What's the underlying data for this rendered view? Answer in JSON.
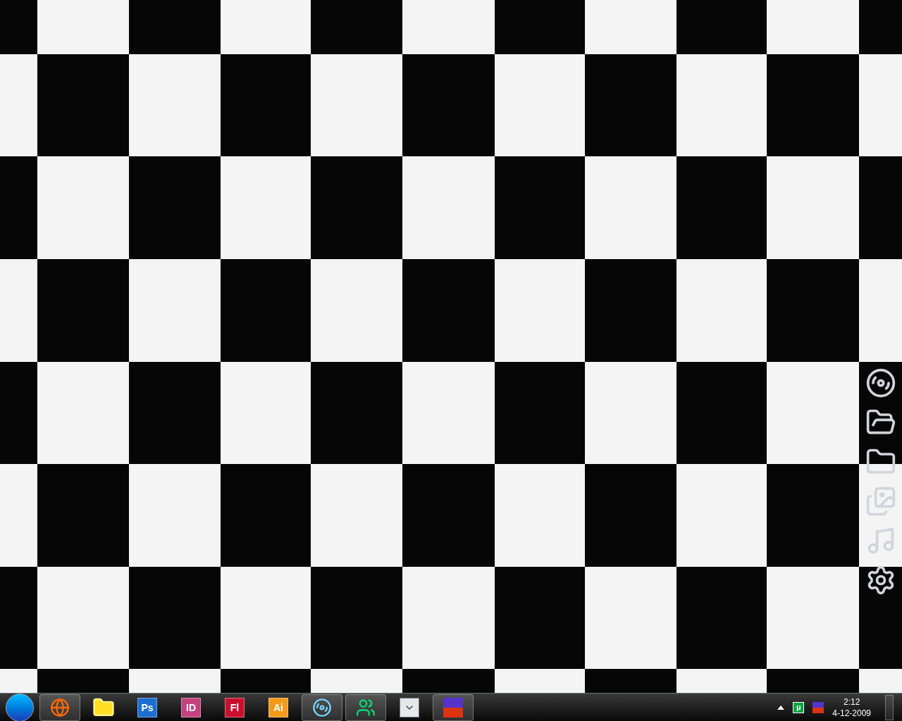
{
  "taskbar": {
    "items": [
      {
        "kind": "firefox",
        "running": true
      },
      {
        "kind": "explorer",
        "running": false
      },
      {
        "kind": "letter",
        "label": "Ps",
        "color": "#1c6fd1",
        "running": false
      },
      {
        "kind": "letter",
        "label": "ID",
        "color": "#c4407f",
        "running": false
      },
      {
        "kind": "letter",
        "label": "Fl",
        "color": "#c8102e",
        "running": false
      },
      {
        "kind": "letter",
        "label": "Ai",
        "color": "#f29b1b",
        "running": false
      },
      {
        "kind": "itunes",
        "running": true
      },
      {
        "kind": "messenger",
        "running": true
      },
      {
        "kind": "dropdown",
        "running": false
      },
      {
        "kind": "mirc",
        "running": true
      }
    ],
    "tray": {
      "torrent_label": "μ",
      "time": "2:12",
      "date": "4-12-2009"
    }
  },
  "dock": {
    "items": [
      {
        "kind": "disc"
      },
      {
        "kind": "user-folder"
      },
      {
        "kind": "folder"
      },
      {
        "kind": "pictures"
      },
      {
        "kind": "music"
      },
      {
        "kind": "settings"
      }
    ]
  }
}
